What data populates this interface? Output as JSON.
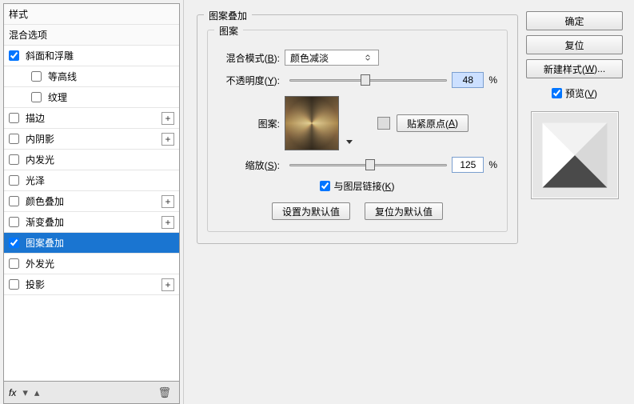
{
  "left": {
    "header_styles": "样式",
    "header_options": "混合选项",
    "items": [
      {
        "label": "斜面和浮雕",
        "checked": true,
        "plus": false
      },
      {
        "label": "等高线",
        "checked": false,
        "indent": true
      },
      {
        "label": "纹理",
        "checked": false,
        "indent": true
      },
      {
        "label": "描边",
        "checked": false,
        "plus": true
      },
      {
        "label": "内阴影",
        "checked": false,
        "plus": true
      },
      {
        "label": "内发光",
        "checked": false
      },
      {
        "label": "光泽",
        "checked": false
      },
      {
        "label": "颜色叠加",
        "checked": false,
        "plus": true
      },
      {
        "label": "渐变叠加",
        "checked": false,
        "plus": true
      },
      {
        "label": "图案叠加",
        "checked": true,
        "selected": true
      },
      {
        "label": "外发光",
        "checked": false
      },
      {
        "label": "投影",
        "checked": false,
        "plus": true
      }
    ],
    "fx": "fx"
  },
  "center": {
    "title_outer": "图案叠加",
    "title_inner": "图案",
    "blend_label_pre": "混合模式(",
    "blend_label_key": "B",
    "blend_label_post": "):",
    "blend_value": "颜色减淡",
    "opacity_label_pre": "不透明度(",
    "opacity_label_key": "Y",
    "opacity_label_post": "):",
    "opacity_value": "48",
    "percent": "%",
    "pattern_label": "图案:",
    "snap_label_pre": "贴紧原点(",
    "snap_label_key": "A",
    "snap_label_post": ")",
    "scale_label_pre": "缩放(",
    "scale_label_key": "S",
    "scale_label_post": "):",
    "scale_value": "125",
    "link_label_pre": "与图层链接(",
    "link_label_key": "K",
    "link_label_post": ")",
    "reset_default": "设置为默认值",
    "restore_default": "复位为默认值"
  },
  "right": {
    "ok": "确定",
    "reset": "复位",
    "new_style_pre": "新建样式(",
    "new_style_key": "W",
    "new_style_post": ")...",
    "preview_pre": "预览(",
    "preview_key": "V",
    "preview_post": ")"
  }
}
